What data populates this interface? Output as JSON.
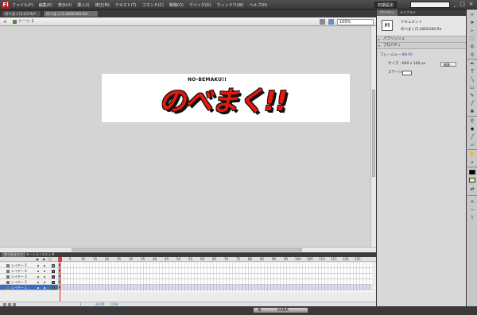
{
  "app": {
    "logo": "Fl"
  },
  "menu": [
    "ファイル(F)",
    "編集(E)",
    "表示(V)",
    "挿入(I)",
    "修正(M)",
    "テキスト(T)",
    "コマンド(C)",
    "制御(O)",
    "デバッグ(D)",
    "ウィンドウ(W)",
    "ヘルプ(H)"
  ],
  "workspace": "初期設定",
  "window_controls": {
    "minimize": "_",
    "restore": "□",
    "close": "×"
  },
  "doc_tabs": [
    "のべまくロゴ3.fla*",
    "のべまくロゴ800160.fla*"
  ],
  "editbar": {
    "scene": "シーン 1",
    "zoom": "100%"
  },
  "stage_content": {
    "subtitle": "NO-BEMAKU!!",
    "title": "のべまく!!"
  },
  "timeline": {
    "tabs": [
      "タイムライン",
      "モーションエディタ"
    ],
    "ruler": [
      "1",
      "5",
      "10",
      "15",
      "20",
      "25",
      "30",
      "35",
      "40",
      "45",
      "50",
      "55",
      "60",
      "65",
      "70",
      "75",
      "80",
      "85",
      "90",
      "95",
      "100",
      "105",
      "110",
      "115",
      "120",
      "125"
    ],
    "layers": [
      {
        "name": "レイヤー 5",
        "color": "#33cccc"
      },
      {
        "name": "レイヤー 4",
        "color": "#9933cc"
      },
      {
        "name": "レイヤー 3",
        "color": "#cc3399"
      },
      {
        "name": "レイヤー 2",
        "color": "#3366ff"
      },
      {
        "name": "レイヤー 1",
        "color": "#33cc33"
      }
    ],
    "selected_layer_index": 4,
    "footer": {
      "frame": "1",
      "fps": "24.00",
      "time": "0.0s"
    }
  },
  "properties": {
    "tabs": [
      "プロパティ",
      "ライブラリ"
    ],
    "doc_badge": "Fl",
    "doc_type": "ドキュメント",
    "doc_name": "のべまくロゴ800160.fla",
    "sections": {
      "publish": "パブリッシュ",
      "props": "プロパティ"
    },
    "fps_label": "フレームレート :",
    "fps_value": "24.00",
    "size_label": "サイズ : 800 x 160 px",
    "edit_button": "編集...",
    "stage_label": "ステージ :"
  },
  "tools": [
    "selection-arrow",
    "subselection",
    "free-transform",
    "3d-rotation",
    "lasso",
    "pen",
    "text",
    "line",
    "rectangle",
    "oval",
    "pencil",
    "brush",
    "deco",
    "bone",
    "paint-bucket",
    "eyedropper",
    "eraser",
    "hand",
    "zoom",
    "stroke-color",
    "fill-color"
  ],
  "ime": {
    "label": "あ",
    "caps": "KANA"
  }
}
